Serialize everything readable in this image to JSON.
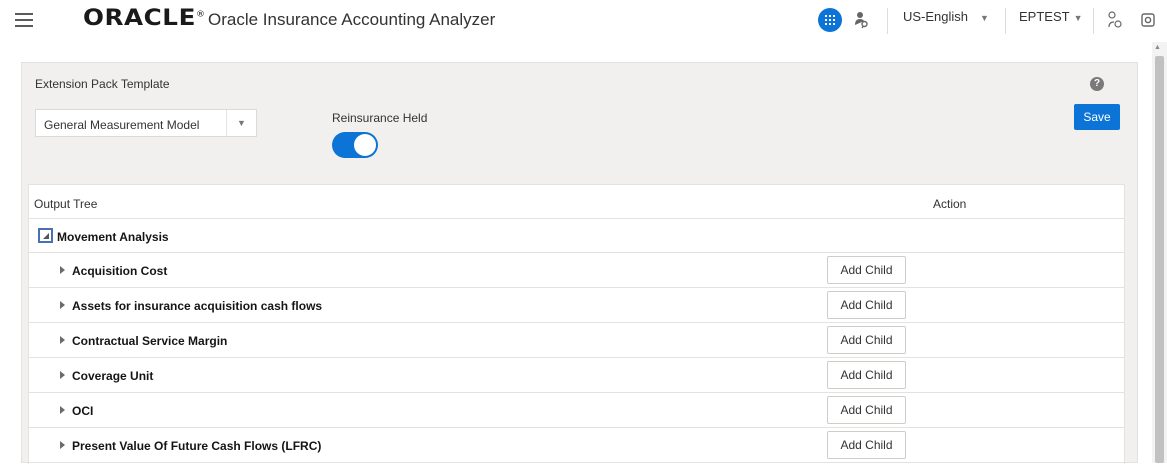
{
  "header": {
    "logo_text": "ORACLE",
    "logo_mark": "®",
    "app_title": "Oracle Insurance Accounting Analyzer",
    "language": "US-English",
    "user": "EPTEST",
    "caret": "▼"
  },
  "panel": {
    "title": "Extension Pack Template",
    "help": "?",
    "save_label": "Save",
    "model_select_value": "General Measurement Model",
    "reinsurance_label": "Reinsurance Held",
    "reinsurance_on": true
  },
  "table": {
    "col_tree": "Output Tree",
    "col_action": "Action",
    "root": "Movement Analysis",
    "add_child_label": "Add Child",
    "children": [
      "Acquisition Cost",
      "Assets for insurance acquisition cash flows",
      "Contractual Service Margin",
      "Coverage Unit",
      "OCI",
      "Present Value Of Future Cash Flows (LFRC)"
    ]
  },
  "colors": {
    "accent": "#0c74d6",
    "panel_bg": "#f1f0ef"
  },
  "icons": [
    "menu-icon",
    "apps-grid-icon",
    "user-icon",
    "hierarchy-icon",
    "settings-icon",
    "help-icon",
    "collapse-icon",
    "expand-icon"
  ]
}
